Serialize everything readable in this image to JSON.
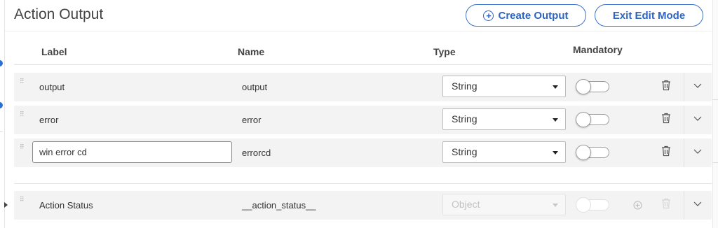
{
  "page": {
    "title": "Action Output"
  },
  "buttons": {
    "create_output": "Create Output",
    "exit_edit_mode": "Exit Edit Mode"
  },
  "columns": {
    "label": "Label",
    "name": "Name",
    "type": "Type",
    "mandatory": "Mandatory"
  },
  "rows": [
    {
      "label": "output",
      "name": "output",
      "type": "String",
      "mandatory": false,
      "editing": false
    },
    {
      "label": "error",
      "name": "error",
      "type": "String",
      "mandatory": false,
      "editing": false
    },
    {
      "label": "win error cd",
      "name": "errorcd",
      "type": "String",
      "mandatory": false,
      "editing": true
    }
  ],
  "system_row": {
    "label": "Action Status",
    "name": "__action_status__",
    "type": "Object",
    "mandatory": false,
    "disabled": true
  },
  "colors": {
    "accent": "#2e64c0",
    "row_bg": "#f3f3f3"
  }
}
